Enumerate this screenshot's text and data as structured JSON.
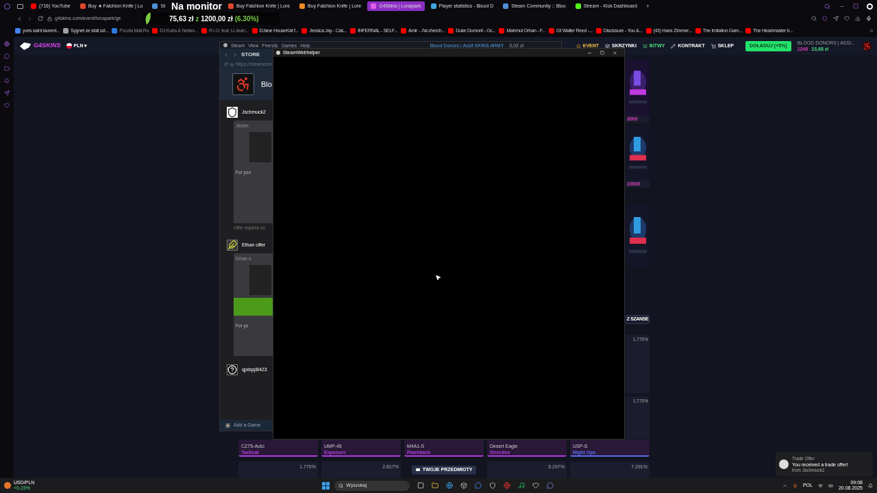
{
  "browser": {
    "tabs": [
      {
        "label": "(716) YouTube",
        "color": "#ff0000",
        "selected": false
      },
      {
        "label": "Buy ★ Falchion Knife | Lo",
        "color": "#e0452a",
        "selected": false
      },
      {
        "label": "St",
        "color": "#4f8fd6",
        "selected": false
      },
      {
        "label": "Buy Falchion Knife | Lore",
        "color": "#e0452a",
        "selected": false
      },
      {
        "label": "Buy Falchion Knife | Lore",
        "color": "#f08a24",
        "selected": false
      },
      {
        "label": "G4Skins | Lunapark",
        "color": "#e35de8",
        "selected": true
      },
      {
        "label": "Player statistics - Blood D",
        "color": "#3fa7e0",
        "selected": false
      },
      {
        "label": "Steam Community :: Bloo",
        "color": "#4f8fd6",
        "selected": false
      },
      {
        "label": "Stream - Kick Dashboard",
        "color": "#53fc18",
        "selected": false
      }
    ],
    "new_tab": "+",
    "overlay_title": "Na monitor",
    "url": "g4skins.com/event/lunapark/ge",
    "goal": {
      "amount": "75,63 zł",
      "sep": "z",
      "target": "1200,00 zł",
      "percent": "(6.30%)"
    },
    "bookmarks": [
      {
        "label": "yves saint laurent...",
        "color": "#4285f4",
        "dimmed": false
      },
      {
        "label": "Sygnet ze stali szl...",
        "color": "#9aa0a6",
        "dimmed": false
      },
      {
        "label": "Poczta Mail.Ru",
        "color": "#2d7be0",
        "dimmed": true
      },
      {
        "label": "DJ Kuba & Neitan...",
        "color": "#ff0000",
        "dimmed": true
      },
      {
        "label": "R.I.O. feat. U-Jean...",
        "color": "#ff0000",
        "dimmed": true
      },
      {
        "label": "DJane HouseKat f...",
        "color": "#ff0000",
        "dimmed": false
      },
      {
        "label": "Jessica Jay - Cas...",
        "color": "#ff0000",
        "dimmed": false
      },
      {
        "label": "INFERNAL - SELF...",
        "color": "#ff0000",
        "dimmed": false
      },
      {
        "label": "Amir - J'ai cherch...",
        "color": "#ff0000",
        "dimmed": false
      },
      {
        "label": "Duke Dumont - Oc...",
        "color": "#ff0000",
        "dimmed": false
      },
      {
        "label": "Mahmut Orhan - F...",
        "color": "#ff0000",
        "dimmed": false
      },
      {
        "label": "03 Walter Reed -...",
        "color": "#ff0000",
        "dimmed": false
      },
      {
        "label": "Disclosure - You &...",
        "color": "#ff0000",
        "dimmed": false
      },
      {
        "label": "(43) Hans Zimmer...",
        "color": "#ff0000",
        "dimmed": false
      },
      {
        "label": "The Imitation Gam...",
        "color": "#ff0000",
        "dimmed": false
      },
      {
        "label": "The Headmaster b...",
        "color": "#ff0000",
        "dimmed": false
      }
    ]
  },
  "site": {
    "logo": "G4SKINS",
    "currency": "PLN",
    "currency_caret": "▾",
    "nav": [
      {
        "label": "EVENT",
        "kind": "event"
      },
      {
        "label": "SKRZYNKI",
        "kind": "cases"
      },
      {
        "label": "BITWY",
        "kind": "battles"
      },
      {
        "label": "KONTRAKT",
        "kind": "contract"
      },
      {
        "label": "SKLEP",
        "kind": "shop"
      }
    ],
    "deposit_button": "DOŁADUJ (+5%)",
    "user": {
      "name": "BLOOD DONORS | ASSI...",
      "points": "1240",
      "balance": "23,68 zł"
    },
    "side_cards": [
      {
        "kind": "value",
        "value": "3000"
      },
      {
        "kind": "value",
        "value": "10000"
      },
      {
        "kind": "picture"
      }
    ],
    "boost_button": "Z SZANSE",
    "side_chances": [
      "1.770%",
      "1.770%"
    ],
    "grid_row_b": [
      {
        "name": "CZ75-Auto",
        "skin": "Tacticat",
        "color": "#b03de0"
      },
      {
        "name": "UMP-45",
        "skin": "Exposure",
        "color": "#b03de0"
      },
      {
        "name": "M4A1-S",
        "skin": "Flashback",
        "color": "#b03de0"
      },
      {
        "name": "Desert Eagle",
        "skin": "Directive",
        "color": "#b03de0"
      },
      {
        "name": "USP-S",
        "skin": "Night Ops",
        "color": "#5a6ef0"
      }
    ],
    "grid_row_c": [
      {
        "kind": "chance",
        "chance": "1.770%"
      },
      {
        "kind": "chance",
        "chance": "2.817%"
      },
      {
        "kind": "button",
        "label": "TWOJE PRZEDMIOTY"
      },
      {
        "kind": "chance",
        "chance": "5.297%"
      },
      {
        "kind": "chance",
        "chance": "7.291%"
      }
    ]
  },
  "steam": {
    "menu": [
      "Steam",
      "View",
      "Friends",
      "Games",
      "Help"
    ],
    "account": "Blood Donors | Assit SKINS ARMY",
    "wallet": "0,02 zł",
    "store": "STORE",
    "url": "https://steamcom",
    "game_title": "Blo",
    "offers": [
      {
        "from": "Jschmuck2",
        "inner": "Jschm",
        "note": "For you",
        "expires": "Offer expires on"
      },
      {
        "from": "Ethan offer",
        "inner": "Ethan o",
        "note": "For yo"
      },
      {
        "from": "qpdqqi8423"
      }
    ],
    "add_game": "Add a Game",
    "helper_title": "SteamWebhelper"
  },
  "toast": {
    "app": "Trade Offer",
    "message": "You received a trade offer!",
    "from": "from Jschmuck2"
  },
  "taskbar": {
    "widget_label": "USD/PLN",
    "widget_change": "+0,23%",
    "search": "Wyszukaj",
    "language": "POL",
    "time": "09:08",
    "date": "20.08.2025"
  }
}
